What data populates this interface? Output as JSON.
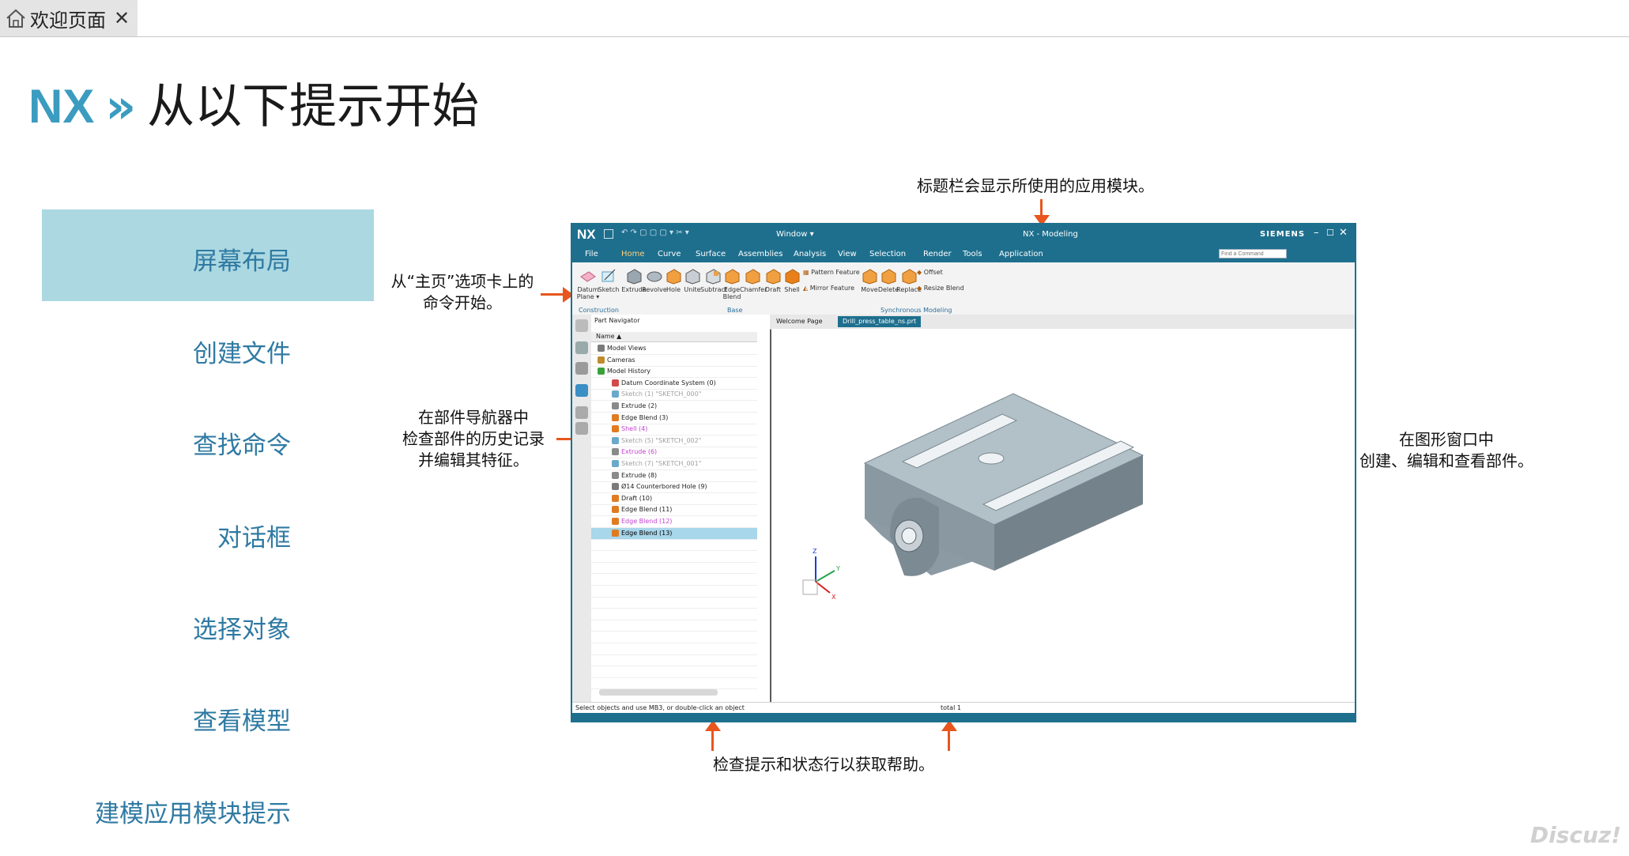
{
  "tab": {
    "label": "欢迎页面",
    "close": "✕"
  },
  "title": {
    "nx": "NX",
    "sep": "»",
    "text": "从以下提示开始"
  },
  "nav": [
    {
      "label": "屏幕布局",
      "active": true
    },
    {
      "label": "创建文件"
    },
    {
      "label": "查找命令"
    },
    {
      "label": "对话框"
    },
    {
      "label": "选择对象"
    },
    {
      "label": "查看模型"
    },
    {
      "label": "建模应用模块提示"
    }
  ],
  "callouts": {
    "titlebar": "标题栏会显示所使用的应用模块。",
    "home_line1": "从“主页”选项卡上的",
    "home_line2": "命令开始。",
    "navigator_line1": "在部件导航器中",
    "navigator_line2": "检查部件的历史记录",
    "navigator_line3": "并编辑其特征。",
    "graphics_line1": "在图形窗口中",
    "graphics_line2": "创建、编辑和查看部件。",
    "status": "检查提示和状态行以获取帮助。"
  },
  "nx_window": {
    "logo": "NX",
    "window_menu": "Window ▾",
    "title": "NX - Modeling",
    "brand": "SIEMENS",
    "search_placeholder": "Find a Command",
    "menu": [
      "File",
      "Home",
      "Curve",
      "Surface",
      "Assemblies",
      "Analysis",
      "View",
      "Selection",
      "Render",
      "Tools",
      "Application"
    ],
    "ribbon": {
      "datum_plane": "Datum Plane ▾",
      "sketch": "Sketch",
      "extrude": "Extrude",
      "revolve": "Revolve",
      "hole": "Hole",
      "unite": "Unite",
      "subtract": "Subtract",
      "edge_blend": "Edge Blend",
      "chamfer": "Chamfer",
      "draft": "Draft",
      "shell": "Shell",
      "pattern_feature": "Pattern Feature",
      "mirror_feature": "Mirror Feature",
      "move": "Move",
      "delete": "Delete",
      "replace": "Replace",
      "offset": "Offset",
      "resize_blend": "Resize Blend",
      "group_construction": "Construction",
      "group_base": "Base",
      "group_sync": "Synchronous Modeling"
    },
    "tabs": {
      "welcome": "Welcome Page",
      "drill": "Drill_press_table_ns.prt"
    },
    "navigator": {
      "title": "Part Navigator",
      "col_name": "Name ▲",
      "rows": [
        {
          "text": "Model Views",
          "indent": 0,
          "color": "#222222",
          "mark": "#7a7a7a"
        },
        {
          "text": "Cameras",
          "indent": 0,
          "color": "#222222",
          "mark": "#c08a2e"
        },
        {
          "text": "Model History",
          "indent": 0,
          "color": "#222222",
          "mark": "#3aa13a"
        },
        {
          "text": "Datum Coordinate System (0)",
          "indent": 1,
          "color": "#222222",
          "mark": "#d24b4b"
        },
        {
          "text": "Sketch (1) \"SKETCH_000\"",
          "indent": 1,
          "color": "#a0a0a0",
          "mark": "#6aa9c9"
        },
        {
          "text": "Extrude (2)",
          "indent": 1,
          "color": "#222222",
          "mark": "#8a8a8a"
        },
        {
          "text": "Edge Blend (3)",
          "indent": 1,
          "color": "#222222",
          "mark": "#e07b22"
        },
        {
          "text": "Shell (4)",
          "indent": 1,
          "color": "#c23fd0",
          "mark": "#e07b22"
        },
        {
          "text": "Sketch (5) \"SKETCH_002\"",
          "indent": 1,
          "color": "#a0a0a0",
          "mark": "#6aa9c9"
        },
        {
          "text": "Extrude (6)",
          "indent": 1,
          "color": "#c23fd0",
          "mark": "#8a8a8a"
        },
        {
          "text": "Sketch (7) \"SKETCH_001\"",
          "indent": 1,
          "color": "#a0a0a0",
          "mark": "#6aa9c9"
        },
        {
          "text": "Extrude (8)",
          "indent": 1,
          "color": "#222222",
          "mark": "#8a8a8a"
        },
        {
          "text": "Ø14 Counterbored Hole (9)",
          "indent": 1,
          "color": "#222222",
          "mark": "#7a7a7a"
        },
        {
          "text": "Draft (10)",
          "indent": 1,
          "color": "#222222",
          "mark": "#e07b22"
        },
        {
          "text": "Edge Blend (11)",
          "indent": 1,
          "color": "#222222",
          "mark": "#e07b22"
        },
        {
          "text": "Edge Blend (12)",
          "indent": 1,
          "color": "#c23fd0",
          "mark": "#e07b22"
        },
        {
          "text": "Edge Blend (13)",
          "indent": 1,
          "color": "#000000",
          "mark": "#e07b22",
          "selected": true
        }
      ]
    },
    "status_left": "Select objects and use MB3, or double-click an object",
    "status_total": "total 1",
    "axes": {
      "z": "Z",
      "y": "Y",
      "x": "X"
    }
  },
  "colors": {
    "accent": "#3b9cc0",
    "arrow": "#e8561e",
    "nx_blue": "#1e6f8e",
    "nav_active_bg": "#acd8e1"
  },
  "watermark": "Discuz!"
}
